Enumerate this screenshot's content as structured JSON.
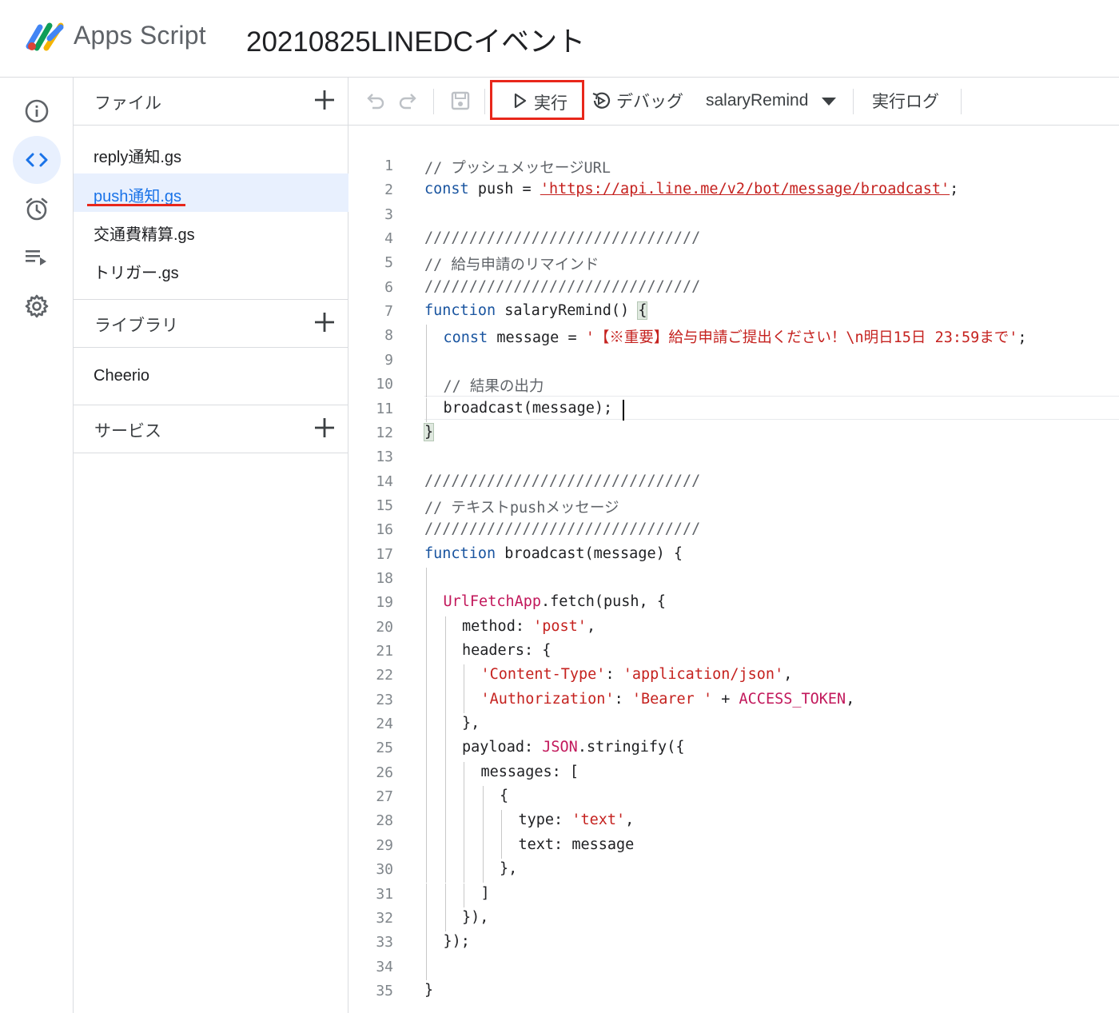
{
  "header": {
    "app_name": "Apps Script",
    "project_title": "20210825LINEDCイベント"
  },
  "rail": {
    "items": [
      {
        "icon": "info-icon"
      },
      {
        "icon": "code-icon",
        "active": true
      },
      {
        "icon": "alarm-icon"
      },
      {
        "icon": "executions-icon"
      },
      {
        "icon": "gear-icon"
      }
    ]
  },
  "files_panel": {
    "files_label": "ファイル",
    "files": [
      "reply通知.gs",
      "push通知.gs",
      "交通費精算.gs",
      "トリガー.gs"
    ],
    "selected_file": "push通知.gs",
    "libraries_label": "ライブラリ",
    "libraries": [
      "Cheerio"
    ],
    "services_label": "サービス"
  },
  "toolbar": {
    "run_label": "実行",
    "debug_label": "デバッグ",
    "function_selected": "salaryRemind",
    "log_label": "実行ログ"
  },
  "colors": {
    "accent": "#1a73e8",
    "highlight_red": "#e8271b",
    "keyword": "#1a55a0",
    "string": "#c5221f",
    "object": "#c2185b",
    "comment": "#5f6368"
  },
  "editor": {
    "line_numbers": [
      "1",
      "2",
      "3",
      "4",
      "5",
      "6",
      "7",
      "8",
      "9",
      "10",
      "11",
      "12",
      "13",
      "14",
      "15",
      "16",
      "17",
      "18",
      "19",
      "20",
      "21",
      "22",
      "23",
      "24",
      "25",
      "26",
      "27",
      "28",
      "29",
      "30",
      "31",
      "32",
      "33",
      "34",
      "35"
    ],
    "lines": [
      {
        "indent": 0,
        "tokens": [
          [
            "c",
            "// プッシュメッセージURL"
          ]
        ]
      },
      {
        "indent": 0,
        "tokens": [
          [
            "k",
            "const"
          ],
          [
            "p",
            " push = "
          ],
          [
            "u",
            "'https://api.line.me/v2/bot/message/broadcast'"
          ],
          [
            "p",
            ";"
          ]
        ]
      },
      {
        "indent": 0,
        "tokens": []
      },
      {
        "indent": 0,
        "tokens": [
          [
            "c",
            "///////////////////////////////"
          ]
        ]
      },
      {
        "indent": 0,
        "tokens": [
          [
            "c",
            "// 給与申請のリマインド"
          ]
        ]
      },
      {
        "indent": 0,
        "tokens": [
          [
            "c",
            "///////////////////////////////"
          ]
        ]
      },
      {
        "indent": 0,
        "tokens": [
          [
            "k",
            "function"
          ],
          [
            "p",
            " salaryRemind() "
          ],
          [
            "b",
            "{"
          ]
        ]
      },
      {
        "indent": 1,
        "tokens": [
          [
            "k",
            "const"
          ],
          [
            "p",
            " message = "
          ],
          [
            "s",
            "'【※重要】給与申請ご提出ください！\\n明日15日 23:59まで'"
          ],
          [
            "p",
            ";"
          ]
        ]
      },
      {
        "indent": 0,
        "tokens": []
      },
      {
        "indent": 1,
        "tokens": [
          [
            "c",
            "// 結果の出力"
          ]
        ]
      },
      {
        "indent": 1,
        "tokens": [
          [
            "p",
            "broadcast(message);"
          ]
        ]
      },
      {
        "indent": 0,
        "tokens": [
          [
            "b",
            "}"
          ]
        ]
      },
      {
        "indent": 0,
        "tokens": []
      },
      {
        "indent": 0,
        "tokens": [
          [
            "c",
            "///////////////////////////////"
          ]
        ]
      },
      {
        "indent": 0,
        "tokens": [
          [
            "c",
            "// テキストpushメッセージ"
          ]
        ]
      },
      {
        "indent": 0,
        "tokens": [
          [
            "c",
            "///////////////////////////////"
          ]
        ]
      },
      {
        "indent": 0,
        "tokens": [
          [
            "k",
            "function"
          ],
          [
            "p",
            " broadcast(message) {"
          ]
        ]
      },
      {
        "indent": 0,
        "tokens": []
      },
      {
        "indent": 1,
        "tokens": [
          [
            "o",
            "UrlFetchApp"
          ],
          [
            "p",
            ".fetch(push, {"
          ]
        ]
      },
      {
        "indent": 2,
        "tokens": [
          [
            "p",
            "method: "
          ],
          [
            "s",
            "'post'"
          ],
          [
            "p",
            ","
          ]
        ]
      },
      {
        "indent": 2,
        "tokens": [
          [
            "p",
            "headers: {"
          ]
        ]
      },
      {
        "indent": 3,
        "tokens": [
          [
            "s",
            "'Content-Type'"
          ],
          [
            "p",
            ": "
          ],
          [
            "s",
            "'application/json'"
          ],
          [
            "p",
            ","
          ]
        ]
      },
      {
        "indent": 3,
        "tokens": [
          [
            "s",
            "'Authorization'"
          ],
          [
            "p",
            ": "
          ],
          [
            "s",
            "'Bearer '"
          ],
          [
            "p",
            " + "
          ],
          [
            "o",
            "ACCESS_TOKEN"
          ],
          [
            "p",
            ","
          ]
        ]
      },
      {
        "indent": 2,
        "tokens": [
          [
            "p",
            "},"
          ]
        ]
      },
      {
        "indent": 2,
        "tokens": [
          [
            "p",
            "payload: "
          ],
          [
            "o",
            "JSON"
          ],
          [
            "p",
            ".stringify({"
          ]
        ]
      },
      {
        "indent": 3,
        "tokens": [
          [
            "p",
            "messages: ["
          ]
        ]
      },
      {
        "indent": 4,
        "tokens": [
          [
            "p",
            "{"
          ]
        ]
      },
      {
        "indent": 5,
        "tokens": [
          [
            "p",
            "type: "
          ],
          [
            "s",
            "'text'"
          ],
          [
            "p",
            ","
          ]
        ]
      },
      {
        "indent": 5,
        "tokens": [
          [
            "p",
            "text: message"
          ]
        ]
      },
      {
        "indent": 4,
        "tokens": [
          [
            "p",
            "},"
          ]
        ]
      },
      {
        "indent": 3,
        "tokens": [
          [
            "p",
            "]"
          ]
        ]
      },
      {
        "indent": 2,
        "tokens": [
          [
            "p",
            "}),"
          ]
        ]
      },
      {
        "indent": 1,
        "tokens": [
          [
            "p",
            "});"
          ]
        ]
      },
      {
        "indent": 0,
        "tokens": []
      },
      {
        "indent": 0,
        "tokens": [
          [
            "p",
            "}"
          ]
        ]
      }
    ]
  }
}
